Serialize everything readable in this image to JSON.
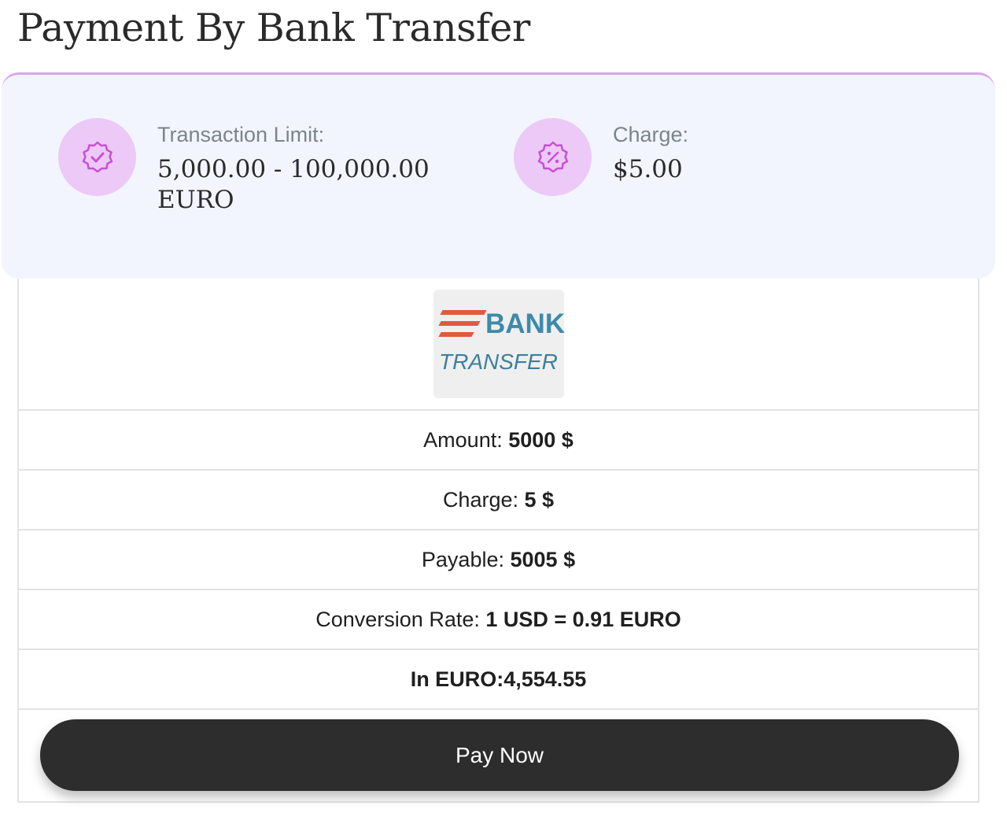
{
  "page": {
    "title": "Payment By Bank Transfer"
  },
  "info": {
    "limit": {
      "icon": "verified-badge-icon",
      "label": "Transaction Limit:",
      "value": "5,000.00 - 100,000.00 EURO"
    },
    "charge": {
      "icon": "discount-badge-icon",
      "label": "Charge:",
      "value": "$5.00"
    },
    "accent_color": "#dba2ef",
    "icon_bg_color": "#ecc9f7",
    "card_bg_color": "#f2f5fd"
  },
  "logo": {
    "line1": "BANK",
    "line2": "TRANSFER",
    "stripe_color": "#e2593b",
    "text_color": "#3d8aa9"
  },
  "details": {
    "amount": {
      "label": "Amount: ",
      "value": "5000 $"
    },
    "charge": {
      "label": "Charge: ",
      "value": "5 $"
    },
    "payable": {
      "label": "Payable: ",
      "value": "5005 $"
    },
    "conversion": {
      "label": "Conversion Rate: ",
      "value": "1 USD = 0.91 EURO"
    },
    "in_currency": {
      "label": "In EURO:",
      "value": "4,554.55"
    }
  },
  "actions": {
    "pay_now_label": "Pay Now",
    "button_color": "#2d2d2d"
  }
}
